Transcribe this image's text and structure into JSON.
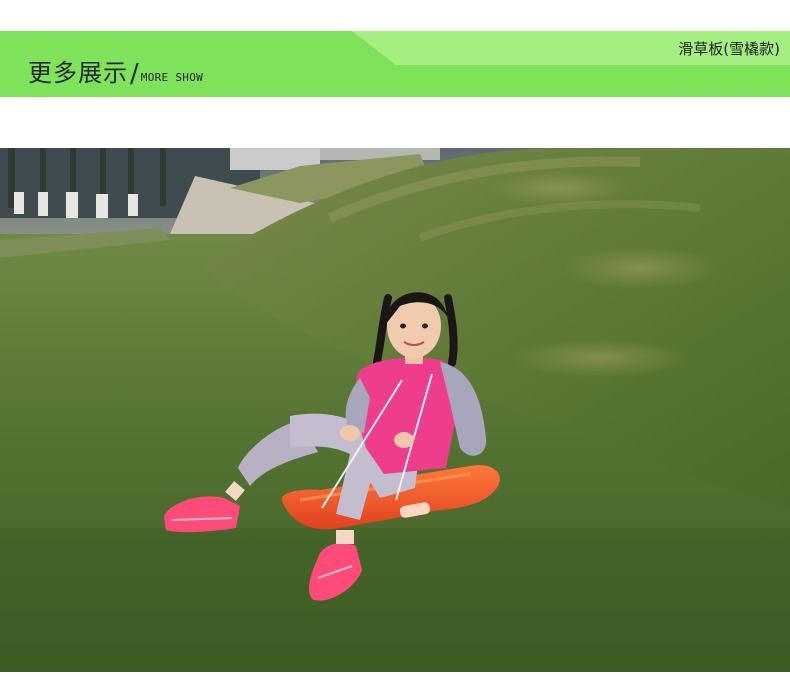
{
  "banner": {
    "title": "更多展示",
    "separator": "/",
    "subtitle": "MORE SHOW",
    "product_tag": "滑草板(雪橇款)",
    "colors": {
      "base": "#7ee25a",
      "light": "#a4ef80",
      "text": "#262626"
    }
  },
  "photo": {
    "subject": "girl-on-orange-grass-sled-photo",
    "colors": {
      "grass": "#5b7a2f",
      "sled": "#f05a2e",
      "jacket": "#ee3d8a",
      "shoes": "#ff4b7a"
    }
  }
}
